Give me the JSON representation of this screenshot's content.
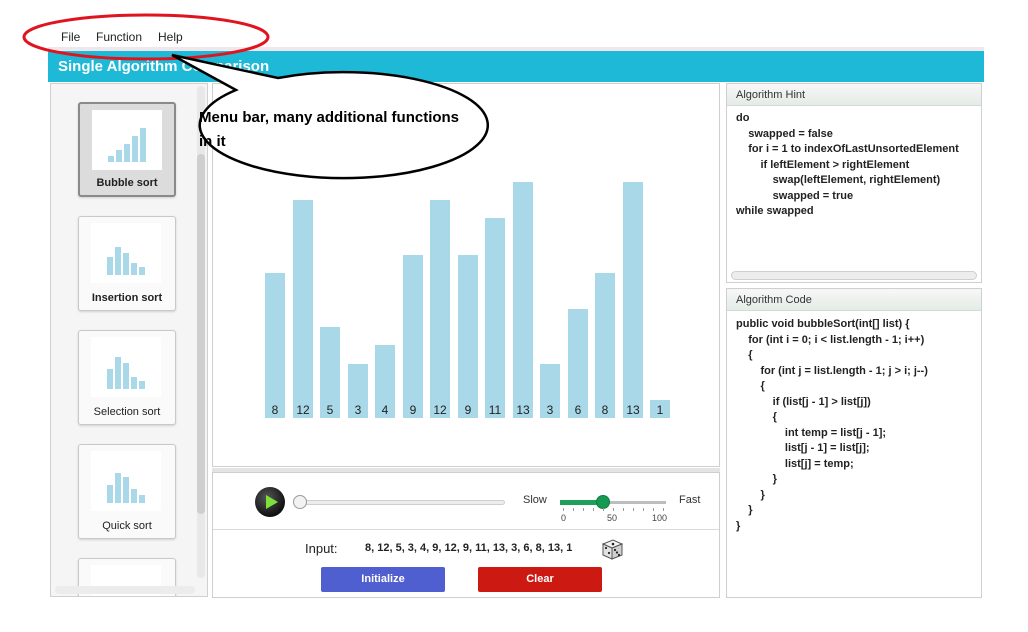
{
  "menu": {
    "items": [
      "File",
      "Function",
      "Help"
    ]
  },
  "title": "Single Algorithm Comparison",
  "sidebar": {
    "items": [
      {
        "label": "Bubble sort",
        "selected": true
      },
      {
        "label": "Insertion sort",
        "selected": false
      },
      {
        "label": "Selection sort",
        "selected": false
      },
      {
        "label": "Quick sort",
        "selected": false
      }
    ]
  },
  "visualization": {
    "values": [
      8,
      12,
      5,
      3,
      4,
      9,
      12,
      9,
      11,
      13,
      3,
      6,
      8,
      13,
      1
    ],
    "bar_color": "#a9d8e8"
  },
  "controls": {
    "speed": {
      "slow_label": "Slow",
      "fast_label": "Fast",
      "value": 40,
      "min_label": "0",
      "mid_label": "50",
      "max_label": "100"
    },
    "progress": 0,
    "input_label": "Input:",
    "input_value": "8, 12, 5, 3, 4, 9, 12, 9, 11, 13, 3, 6, 8, 13, 1",
    "initialize_label": "Initialize",
    "clear_label": "Clear",
    "initialize_color": "#4f5fd0",
    "clear_color": "#cc1a12"
  },
  "hint": {
    "title": "Algorithm Hint",
    "lines": [
      "do",
      "    swapped = false",
      "    for i = 1 to indexOfLastUnsortedElement",
      "        if leftElement > rightElement",
      "            swap(leftElement, rightElement)",
      "            swapped = true",
      "while swapped"
    ]
  },
  "code": {
    "title": "Algorithm Code",
    "lines": [
      "public void bubbleSort(int[] list) {",
      "    for (int i = 0; i < list.length - 1; i++)",
      "    {",
      "        for (int j = list.length - 1; j > i; j--)",
      "        {",
      "            if (list[j - 1] > list[j])",
      "            {",
      "                int temp = list[j - 1];",
      "                list[j - 1] = list[j];",
      "                list[j] = temp;",
      "            }",
      "        }",
      "    }",
      "}"
    ]
  },
  "annotation": {
    "text": "Menu bar, many additional functions in it"
  },
  "colors": {
    "title_bar": "#1db9d6",
    "callout_ellipse": "#e0141e"
  }
}
